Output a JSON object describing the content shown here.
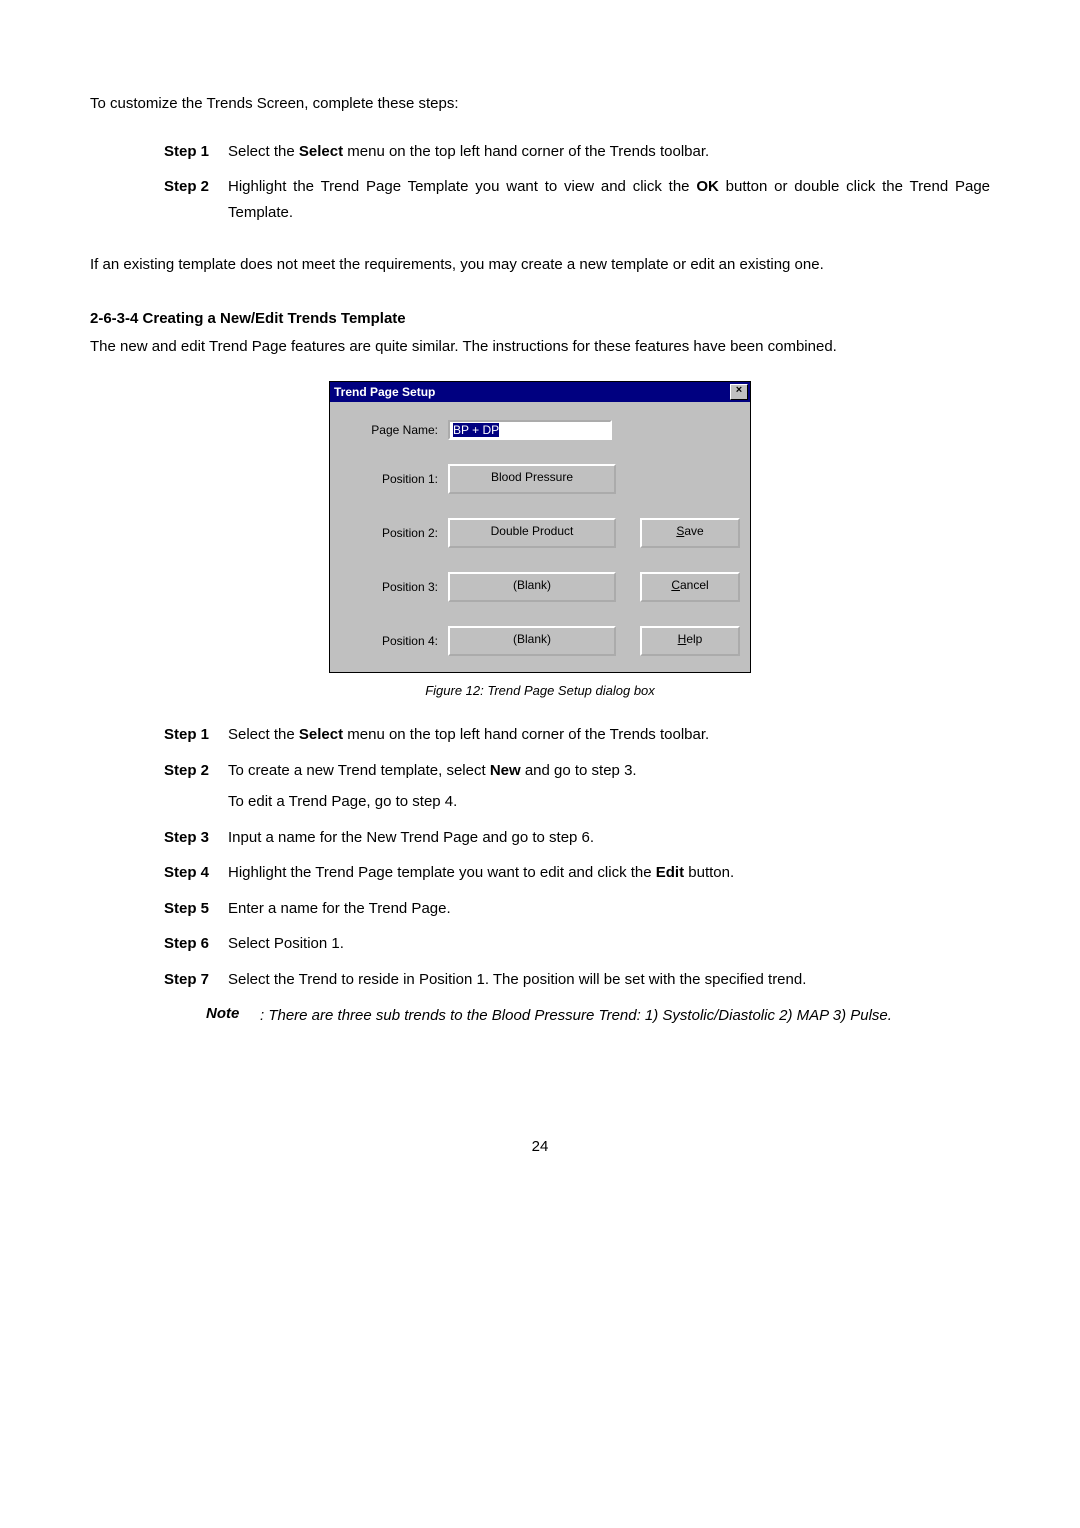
{
  "intro": "To customize the Trends Screen, complete these steps:",
  "topSteps": [
    {
      "label": "Step 1",
      "before": "Select the ",
      "bold": "Select",
      "after": " menu on the top left hand corner of the Trends toolbar."
    },
    {
      "label": "Step 2",
      "before": "Highlight the Trend Page Template you want to view and click the ",
      "bold": "OK",
      "after": " button or double click the Trend Page Template."
    }
  ],
  "midPara": "If an existing template does not meet the requirements, you may create a new template or edit an existing one.",
  "heading": "2-6-3-4 Creating a New/Edit Trends Template",
  "headPara": "The new and edit Trend Page features are quite similar. The instructions for these features have been combined.",
  "dialog": {
    "title": "Trend Page Setup",
    "close": "×",
    "pageNameLabel": "Page Name:",
    "pageNameValue": "BP + DP",
    "rows": [
      {
        "label": "Position 1:",
        "btn": "Blood Pressure",
        "action": ""
      },
      {
        "label": "Position 2:",
        "btn": "Double Product",
        "action": "Save",
        "mn": "S"
      },
      {
        "label": "Position 3:",
        "btn": "(Blank)",
        "action": "Cancel",
        "mn": "C"
      },
      {
        "label": "Position 4:",
        "btn": "(Blank)",
        "action": "Help",
        "mn": "H"
      }
    ]
  },
  "caption": "Figure 12: Trend Page Setup dialog box",
  "steps": [
    {
      "label": "Step 1",
      "before": "Select the ",
      "bold": "Select",
      "after": " menu on the top left hand corner of the Trends toolbar."
    },
    {
      "label": "Step 2",
      "before": "To create a new Trend template, select ",
      "bold": "New",
      "after": " and go to step 3.",
      "line2": "To edit a Trend Page, go to step 4."
    },
    {
      "label": "Step 3",
      "before": "Input a name for the New Trend Page and go to step 6.",
      "bold": "",
      "after": ""
    },
    {
      "label": "Step 4",
      "before": "Highlight the Trend Page template you want to edit and click the ",
      "bold": "Edit",
      "after": " button."
    },
    {
      "label": "Step 5",
      "before": "Enter a name for the Trend Page.",
      "bold": "",
      "after": ""
    },
    {
      "label": "Step 6",
      "before": "Select Position 1.",
      "bold": "",
      "after": ""
    },
    {
      "label": "Step 7",
      "before": "Select the Trend to reside in Position 1. The position will be set with the specified trend.",
      "bold": "",
      "after": ""
    }
  ],
  "note": {
    "label": "Note",
    "text": ": There are three sub trends to the Blood Pressure Trend: 1) Systolic/Diastolic 2) MAP 3) Pulse."
  },
  "pageNum": "24"
}
